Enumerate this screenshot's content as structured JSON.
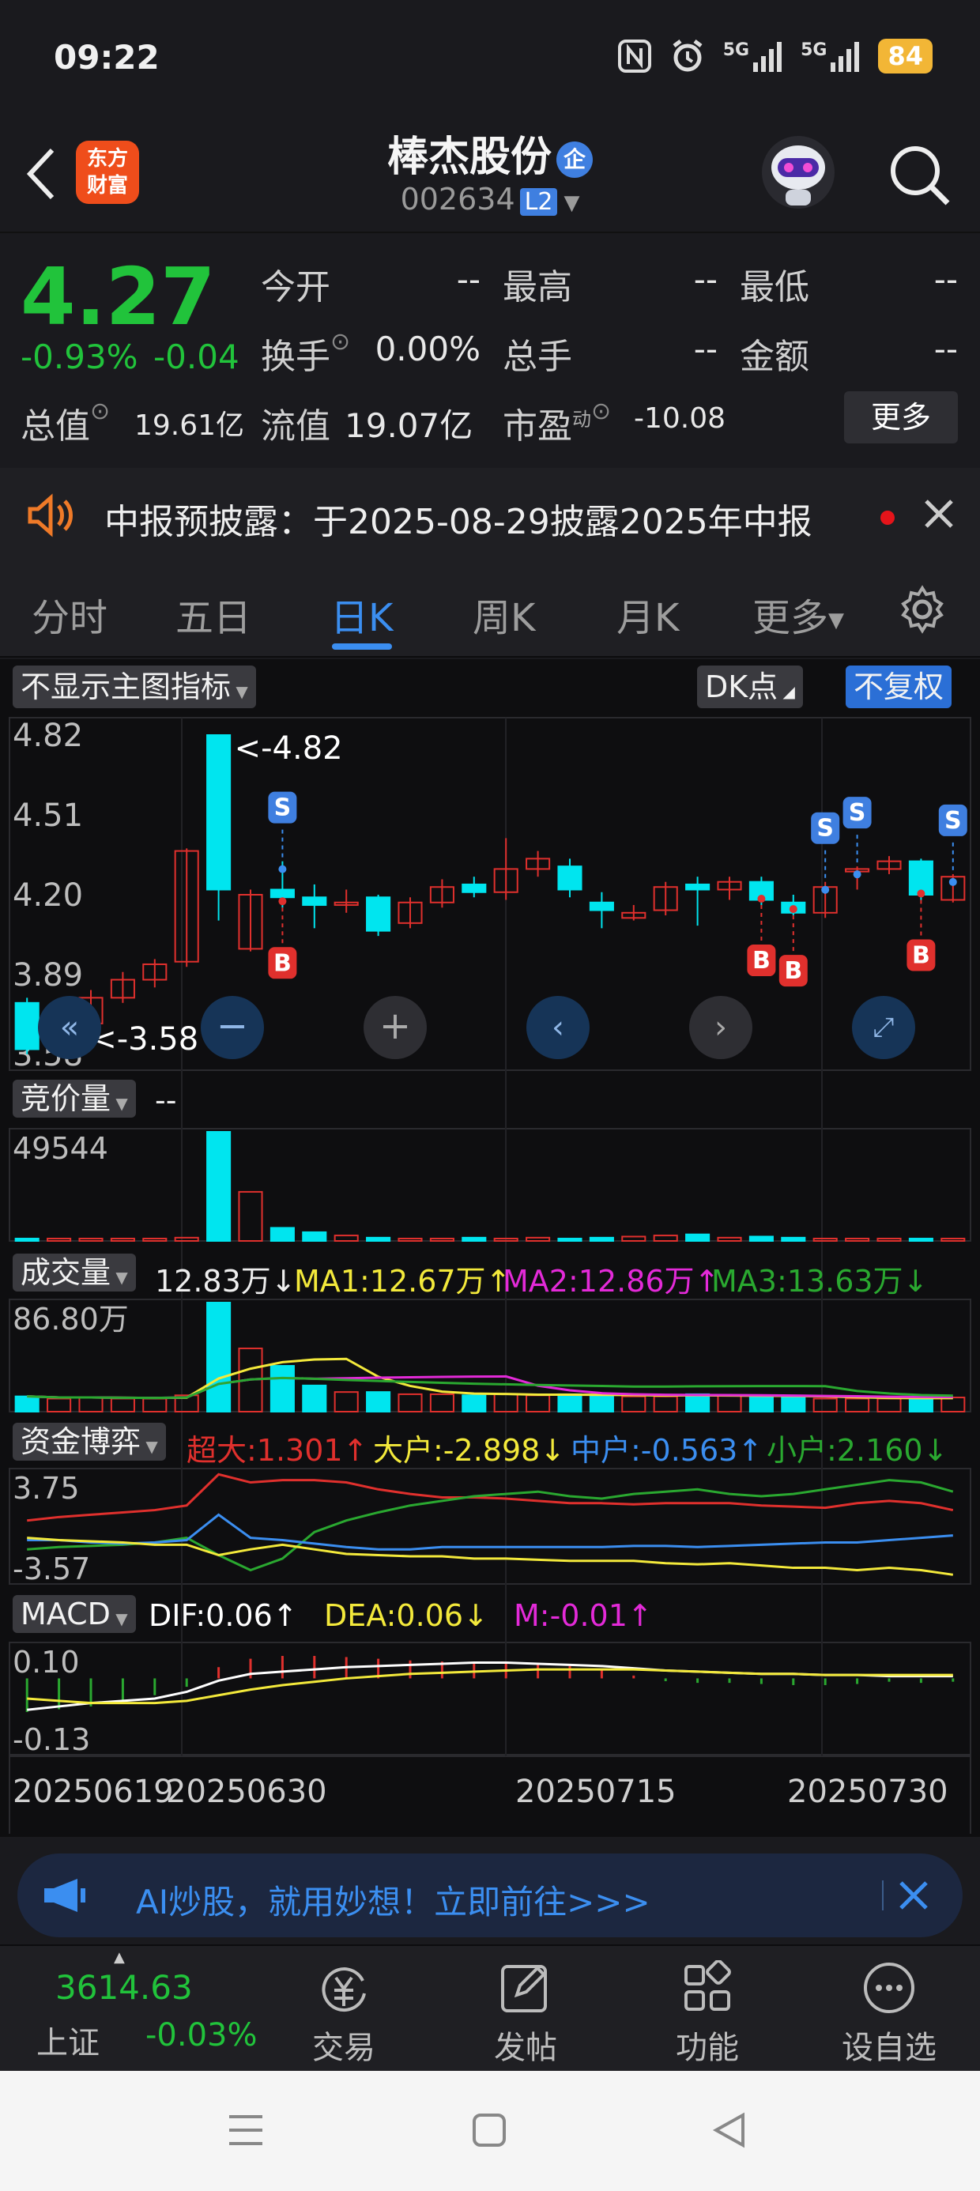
{
  "status_bar": {
    "time": "09:22",
    "battery": "84",
    "signal1": "5G",
    "signal2": "5G"
  },
  "header": {
    "logo_line1": "东方",
    "logo_line2": "财富",
    "stock_name": "棒杰股份",
    "badge": "企",
    "code": "002634",
    "level": "L2"
  },
  "quote": {
    "price": "4.27",
    "change_pct": "-0.93%",
    "change_abs": "-0.04",
    "open_label": "今开",
    "open_value": "--",
    "high_label": "最高",
    "high_value": "--",
    "low_label": "最低",
    "low_value": "--",
    "turnover_label": "换手",
    "turnover_value": "0.00%",
    "volume_label": "总手",
    "volume_value": "--",
    "amount_label": "金额",
    "amount_value": "--",
    "mktcap_label": "总值",
    "mktcap_value": "19.61亿",
    "float_label": "流值",
    "float_value": "19.07亿",
    "pe_label": "市盈",
    "pe_sup": "动",
    "pe_value": "-10.08",
    "more_label": "更多"
  },
  "notice": {
    "text": "中报预披露：于2025-08-29披露2025年中报"
  },
  "tabs": [
    "分时",
    "五日",
    "日K",
    "周K",
    "月K",
    "更多"
  ],
  "active_tab": 2,
  "chart_controls": {
    "main_indicator": "不显示主图指标",
    "dk_label": "DK点",
    "fq_label": "不复权"
  },
  "chart_data": {
    "type": "candlestick",
    "y_ticks": [
      "4.82",
      "4.51",
      "4.20",
      "3.89",
      "3.58"
    ],
    "ylim": [
      3.58,
      4.82
    ],
    "max_label": "<-4.82",
    "min_label": "<-3.58",
    "x_ticks": [
      "20250619",
      "20250630",
      "20250715",
      "20250730"
    ],
    "candles": [
      {
        "o": 3.78,
        "c": 3.6,
        "h": 3.8,
        "l": 3.58
      },
      {
        "o": 3.62,
        "c": 3.72,
        "h": 3.74,
        "l": 3.6
      },
      {
        "o": 3.7,
        "c": 3.8,
        "h": 3.83,
        "l": 3.68
      },
      {
        "o": 3.8,
        "c": 3.87,
        "h": 3.9,
        "l": 3.78
      },
      {
        "o": 3.87,
        "c": 3.93,
        "h": 3.95,
        "l": 3.84
      },
      {
        "o": 3.94,
        "c": 4.37,
        "h": 4.38,
        "l": 3.92
      },
      {
        "o": 4.82,
        "c": 4.22,
        "h": 4.82,
        "l": 4.1
      },
      {
        "o": 3.99,
        "c": 4.2,
        "h": 4.22,
        "l": 3.98
      },
      {
        "o": 4.22,
        "c": 4.19,
        "h": 4.33,
        "l": 4.15
      },
      {
        "o": 4.19,
        "c": 4.16,
        "h": 4.24,
        "l": 4.07
      },
      {
        "o": 4.16,
        "c": 4.17,
        "h": 4.22,
        "l": 4.13
      },
      {
        "o": 4.19,
        "c": 4.06,
        "h": 4.2,
        "l": 4.04
      },
      {
        "o": 4.09,
        "c": 4.17,
        "h": 4.19,
        "l": 4.07
      },
      {
        "o": 4.17,
        "c": 4.23,
        "h": 4.26,
        "l": 4.15
      },
      {
        "o": 4.24,
        "c": 4.21,
        "h": 4.27,
        "l": 4.19
      },
      {
        "o": 4.21,
        "c": 4.3,
        "h": 4.42,
        "l": 4.18
      },
      {
        "o": 4.3,
        "c": 4.34,
        "h": 4.37,
        "l": 4.27
      },
      {
        "o": 4.31,
        "c": 4.22,
        "h": 4.34,
        "l": 4.19
      },
      {
        "o": 4.17,
        "c": 4.14,
        "h": 4.21,
        "l": 4.07
      },
      {
        "o": 4.11,
        "c": 4.13,
        "h": 4.16,
        "l": 4.1
      },
      {
        "o": 4.14,
        "c": 4.23,
        "h": 4.25,
        "l": 4.12
      },
      {
        "o": 4.24,
        "c": 4.22,
        "h": 4.27,
        "l": 4.08
      },
      {
        "o": 4.22,
        "c": 4.25,
        "h": 4.27,
        "l": 4.18
      },
      {
        "o": 4.25,
        "c": 4.18,
        "h": 4.27,
        "l": 4.16
      },
      {
        "o": 4.17,
        "c": 4.13,
        "h": 4.2,
        "l": 4.12
      },
      {
        "o": 4.13,
        "c": 4.23,
        "h": 4.25,
        "l": 4.11
      },
      {
        "o": 4.29,
        "c": 4.3,
        "h": 4.31,
        "l": 4.22
      },
      {
        "o": 4.3,
        "c": 4.33,
        "h": 4.35,
        "l": 4.28
      },
      {
        "o": 4.33,
        "c": 4.2,
        "h": 4.34,
        "l": 4.18
      },
      {
        "o": 4.18,
        "c": 4.27,
        "h": 4.28,
        "l": 4.17
      }
    ],
    "signals": [
      {
        "i": 8,
        "t": "S"
      },
      {
        "i": 8,
        "t": "B"
      },
      {
        "i": 23,
        "t": "B"
      },
      {
        "i": 24,
        "t": "B"
      },
      {
        "i": 25,
        "t": "S"
      },
      {
        "i": 26,
        "t": "S"
      },
      {
        "i": 28,
        "t": "B"
      },
      {
        "i": 29,
        "t": "S"
      }
    ],
    "auction": {
      "label": "竞价量",
      "value": "--",
      "max_label": "49544",
      "bars": [
        0.02,
        0.01,
        0.01,
        0.01,
        0.01,
        0.03,
        1.0,
        0.45,
        0.12,
        0.08,
        0.05,
        0.03,
        0.02,
        0.02,
        0.03,
        0.02,
        0.03,
        0.02,
        0.03,
        0.04,
        0.05,
        0.06,
        0.03,
        0.04,
        0.03,
        0.02,
        0.02,
        0.02,
        0.02,
        0.01
      ]
    },
    "volume": {
      "label": "成交量",
      "value": "12.83万↓",
      "ma1": "MA1:12.67万↑",
      "ma2": "MA2:12.86万↑",
      "ma3": "MA3:13.63万↓",
      "max_label": "86.80万",
      "bars": [
        0.14,
        0.12,
        0.13,
        0.12,
        0.12,
        0.15,
        1.0,
        0.58,
        0.42,
        0.24,
        0.18,
        0.18,
        0.16,
        0.16,
        0.15,
        0.16,
        0.15,
        0.16,
        0.15,
        0.14,
        0.14,
        0.16,
        0.15,
        0.14,
        0.13,
        0.12,
        0.12,
        0.12,
        0.13,
        0.13
      ]
    },
    "capital": {
      "label": "资金博弈",
      "super": "超大:1.301↑",
      "big": "大户:-2.898↓",
      "mid": "中户:-0.563↑",
      "small": "小户:2.160↓",
      "top_label": "3.75",
      "bottom_label": "-3.57"
    },
    "macd": {
      "label": "MACD",
      "dif": "DIF:0.06↑",
      "dea": "DEA:0.06↓",
      "m": "M:-0.01↑",
      "top_label": "0.10",
      "bottom_label": "-0.13"
    },
    "colors": {
      "up": "#e0302d",
      "down": "#00e5ef",
      "ma1": "#f3e93b",
      "ma2": "#e32ad8",
      "ma3": "#2aa830",
      "blue": "#3b8ef0"
    }
  },
  "ad": {
    "text": "AI炒股，就用妙想！立即前往>>>"
  },
  "bottom_tabs": {
    "index_value": "3614.63",
    "index_name": "上证",
    "index_change": "-0.03%",
    "items": [
      "交易",
      "发帖",
      "功能",
      "设自选"
    ]
  }
}
